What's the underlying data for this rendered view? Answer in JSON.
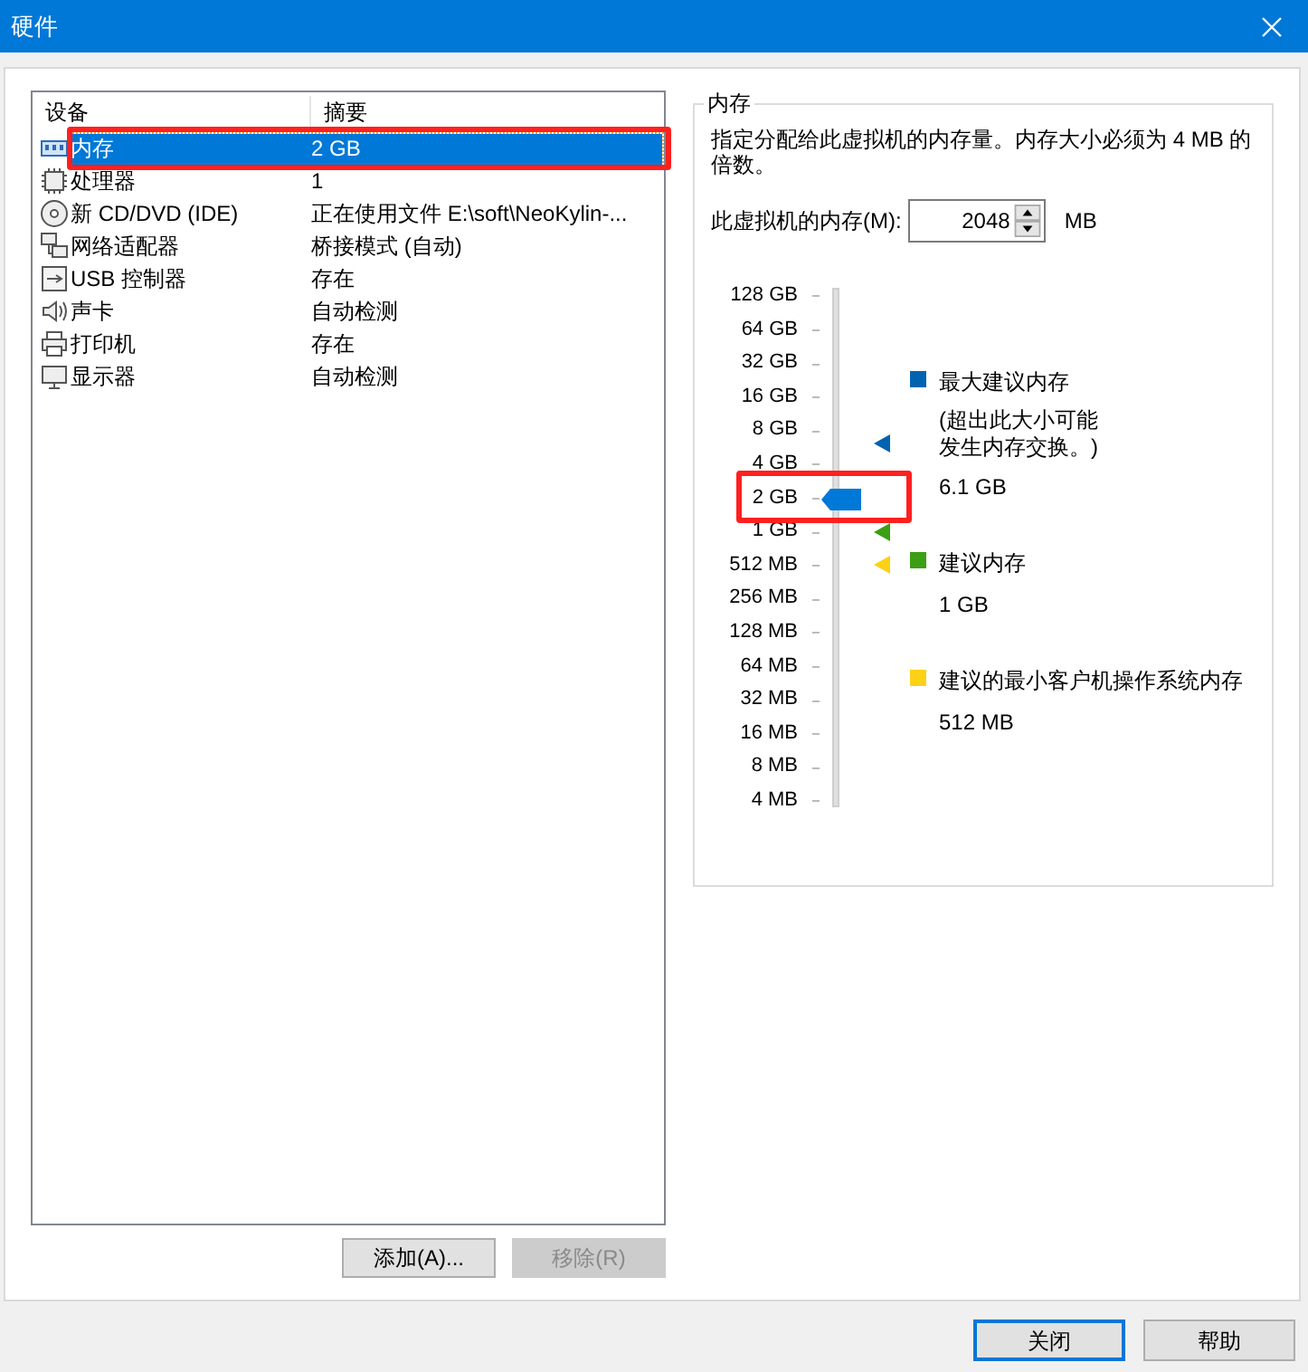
{
  "window": {
    "title": "硬件"
  },
  "devices": {
    "columns": [
      "设备",
      "摘要"
    ],
    "rows": [
      {
        "kind": "memory",
        "device": "内存",
        "summary": "2 GB",
        "selected": true,
        "annotated": true
      },
      {
        "kind": "cpu",
        "device": "处理器",
        "summary": "1",
        "selected": false,
        "annotated": false
      },
      {
        "kind": "disc",
        "device": "新 CD/DVD (IDE)",
        "summary": "正在使用文件 E:\\soft\\NeoKylin-...",
        "selected": false,
        "annotated": false
      },
      {
        "kind": "network",
        "device": "网络适配器",
        "summary": "桥接模式 (自动)",
        "selected": false,
        "annotated": false
      },
      {
        "kind": "usb",
        "device": "USB 控制器",
        "summary": "存在",
        "selected": false,
        "annotated": false
      },
      {
        "kind": "sound",
        "device": "声卡",
        "summary": "自动检测",
        "selected": false,
        "annotated": false
      },
      {
        "kind": "printer",
        "device": "打印机",
        "summary": "存在",
        "selected": false,
        "annotated": false
      },
      {
        "kind": "display",
        "device": "显示器",
        "summary": "自动检测",
        "selected": false,
        "annotated": false
      }
    ]
  },
  "list_buttons": [
    {
      "label": "添加(A)...",
      "disabled": false
    },
    {
      "label": "移除(R)",
      "disabled": true
    }
  ],
  "memory": {
    "title": "内存",
    "description": "指定分配给此虚拟机的内存量。内存大小必须为 4 MB 的倍数。",
    "field_label": "此虚拟机的内存(M):",
    "value": "2048",
    "unit": "MB",
    "scale": {
      "ticks": [
        "128 GB",
        "64 GB",
        "32 GB",
        "16 GB",
        "8 GB",
        "4 GB",
        "2 GB",
        "1 GB",
        "512 MB",
        "256 MB",
        "128 MB",
        "64 MB",
        "32 MB",
        "16 MB",
        "8 MB",
        "4 MB"
      ],
      "level": 0.6,
      "annotated": true
    },
    "legend": [
      {
        "color": "#0063b1",
        "label": "最大建议内存",
        "note": "(超出此大小可能发生内存交换。)",
        "value": "6.1 GB"
      },
      {
        "color": "#3c9e14",
        "label": "建议内存",
        "value": "1 GB"
      },
      {
        "color": "#fcd116",
        "label": "建议的最小客户机操作系统内存",
        "value": "512 MB"
      }
    ]
  },
  "footer_buttons": [
    {
      "label": "关闭",
      "selected": true
    },
    {
      "label": "帮助",
      "selected": false
    }
  ]
}
